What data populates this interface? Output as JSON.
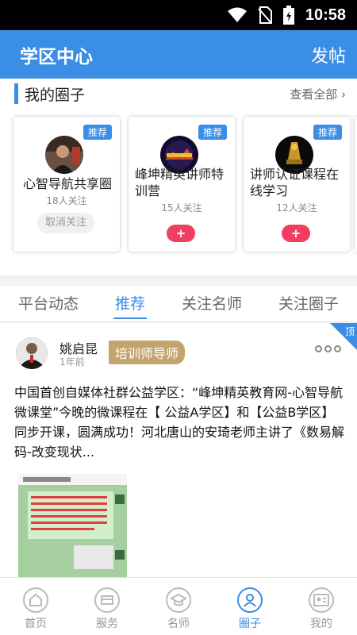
{
  "status_bar": {
    "time": "10:58"
  },
  "app_bar": {
    "title": "学区中心",
    "post_label": "发帖"
  },
  "my_circles": {
    "title": "我的圈子",
    "view_all": "查看全部 ›",
    "cards": [
      {
        "tag": "推荐",
        "name": "心智导航共享圈",
        "followers": "18人关注",
        "action": "取消关注"
      },
      {
        "tag": "推荐",
        "name": "峰坤精英讲师特训营",
        "followers": "15人关注",
        "action": "+"
      },
      {
        "tag": "推荐",
        "name": "讲师认证课程在线学习",
        "followers": "12人关注",
        "action": "+"
      }
    ]
  },
  "tabs": [
    "平台动态",
    "推荐",
    "关注名师",
    "关注圈子"
  ],
  "active_tab": "推荐",
  "post": {
    "pin_label": "顶",
    "author": "姚启昆",
    "time": "1年前",
    "badge": "培训师导师",
    "text": "中国首创自媒体社群公益学区：“峰坤精英教育网-心智导航微课堂”今晚的微课程在【 公益A学区】和【公益B学区】同步开课，圆满成功！河北唐山的安琦老师主讲了《数易解码-改变现状..."
  },
  "bottom_nav": [
    {
      "label": "首页",
      "icon": "home-icon"
    },
    {
      "label": "服务",
      "icon": "service-icon"
    },
    {
      "label": "名师",
      "icon": "teacher-icon"
    },
    {
      "label": "圈子",
      "icon": "circle-icon"
    },
    {
      "label": "我的",
      "icon": "profile-icon"
    }
  ],
  "colors": {
    "primary": "#3b8ee5",
    "accent": "#ef3e5f",
    "badge": "#c4a46e"
  }
}
